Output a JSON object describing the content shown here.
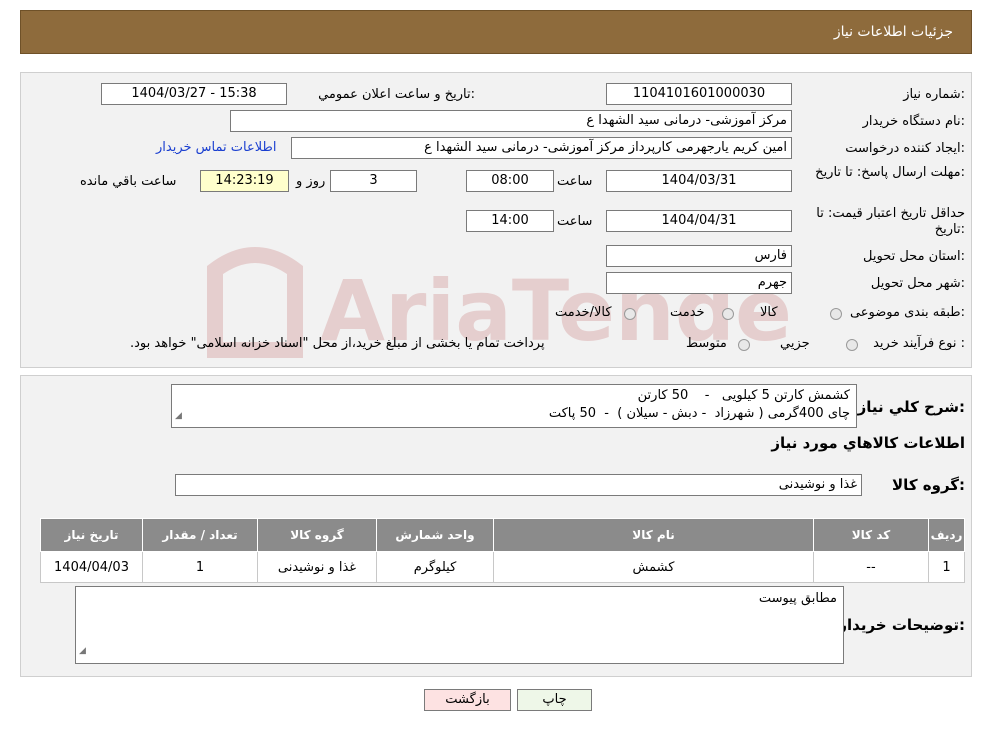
{
  "header": {
    "title": "جزئيات اطلاعات نياز"
  },
  "watermark": {
    "text": "AriaTender.neT"
  },
  "form": {
    "need_number_label": "شماره نياز:",
    "need_number": "1104101601000030",
    "announce_label": "تاريخ و ساعت اعلان عمومي:",
    "announce_value": "1404/03/27 - 15:38",
    "buyer_org_label": "نام دستگاه خريدار:",
    "buyer_org": "مرکز آموزشی- درمانی سید الشهدا ع",
    "creator_label": "ايجاد کننده درخواست:",
    "creator": "امین کریم یارجهرمی کارپرداز مرکز آموزشی- درمانی سید الشهدا ع",
    "contact_link": "اطلاعات تماس خريدار",
    "deadline_label": "مهلت ارسال پاسخ: تا تاريخ:",
    "deadline_date": "1404/03/31",
    "time_label": "ساعت",
    "deadline_time": "08:00",
    "days_value": "3",
    "days_label": "روز و",
    "remaining_time": "14:23:19",
    "remaining_label": "ساعت باقي مانده",
    "validity_label": "حداقل تاريخ اعتبار قيمت: تا تاريخ:",
    "validity_date": "1404/04/31",
    "validity_time": "14:00",
    "province_label": "استان محل تحويل:",
    "province": "فارس",
    "city_label": "شهر محل تحويل:",
    "city": "جهرم",
    "category_label": "طبقه بندی موضوعی:",
    "category_options": [
      "کالا",
      "خدمت",
      "کالا/خدمت"
    ],
    "process_label": "نوع فرآيند خريد :",
    "process_options": [
      "جزيي",
      "متوسط"
    ],
    "process_note": "پرداخت تمام يا بخشی از مبلغ خريد،از محل \"اسناد خزانه اسلامی\" خواهد بود."
  },
  "summary": {
    "label": "شرح کلي نياز:",
    "line1": "کشمش کارتن 5 کیلویی   -    50 کارتن",
    "line2": "چای 400گرمی ( شهرزاد  - دبش - سیلان )  -  50 پاکت",
    "goods_info_title": "اطلاعات کالاهاي مورد نياز",
    "group_label": "گروه کالا:",
    "group_value": "غذا و نوشیدنی"
  },
  "table": {
    "headers": [
      "رديف",
      "کد کالا",
      "نام کالا",
      "واحد شمارش",
      "گروه کالا",
      "تعداد / مقدار",
      "تاريخ نياز"
    ],
    "rows": [
      [
        "1",
        "--",
        "کشمش",
        "کیلوگرم",
        "غذا و نوشیدنی",
        "1",
        "1404/04/03"
      ]
    ]
  },
  "buyer_notes": {
    "label": "توضيحات خريدار:",
    "value": "مطابق پیوست"
  },
  "buttons": {
    "print": "چاپ",
    "back": "بازگشت"
  }
}
